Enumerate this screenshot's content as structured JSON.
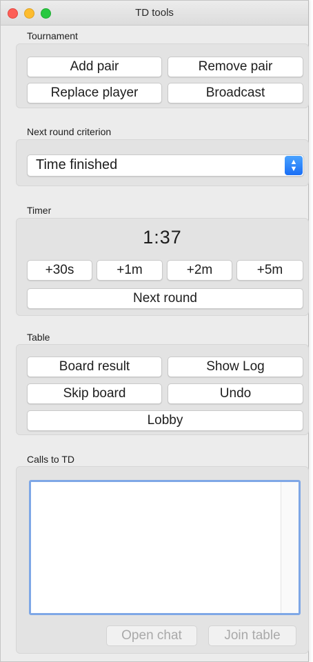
{
  "window": {
    "title": "TD tools"
  },
  "tournament": {
    "label": "Tournament",
    "add_pair": "Add pair",
    "remove_pair": "Remove pair",
    "replace_player": "Replace player",
    "broadcast": "Broadcast"
  },
  "criterion": {
    "label": "Next round criterion",
    "selected": "Time finished"
  },
  "timer": {
    "label": "Timer",
    "display": "1:37",
    "plus30s": "+30s",
    "plus1m": "+1m",
    "plus2m": "+2m",
    "plus5m": "+5m",
    "next_round": "Next round"
  },
  "table": {
    "label": "Table",
    "board_result": "Board result",
    "show_log": "Show Log",
    "skip_board": "Skip board",
    "undo": "Undo",
    "lobby": "Lobby"
  },
  "calls": {
    "label": "Calls to TD",
    "items": [],
    "open_chat": "Open chat",
    "join_table": "Join table"
  },
  "colors": {
    "close": "#fd5f57",
    "minimize": "#fdbc2e",
    "maximize": "#28c840",
    "focus_ring": "#7ea7e6",
    "select_accent": "#1a6ef5"
  }
}
